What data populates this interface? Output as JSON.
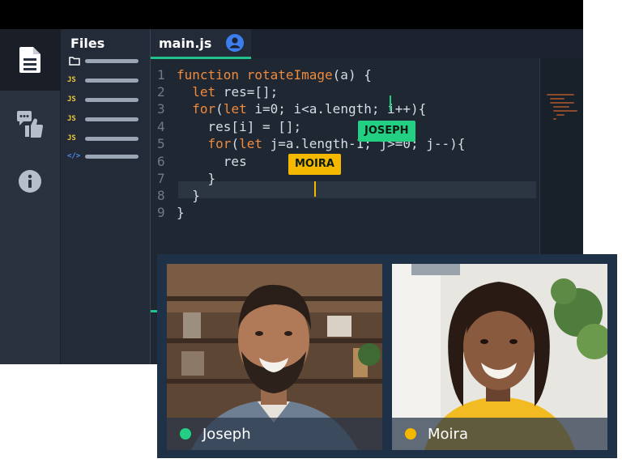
{
  "colors": {
    "joseph": "#23d083",
    "moira": "#f5b800",
    "accent": "#1fc28a",
    "tab_avatar": "#3c7df0"
  },
  "activity_bar": {
    "items": [
      {
        "icon": "document-icon",
        "active": true
      },
      {
        "icon": "chat-like-icon",
        "active": false
      },
      {
        "icon": "info-icon",
        "active": false
      }
    ]
  },
  "files_panel": {
    "title": "Files",
    "items": [
      {
        "type": "folder",
        "icon": "folder-icon",
        "label": ""
      },
      {
        "type": "js",
        "icon": "js-file-icon",
        "label": "JS"
      },
      {
        "type": "js",
        "icon": "js-file-icon",
        "label": "JS"
      },
      {
        "type": "js",
        "icon": "js-file-icon",
        "label": "JS"
      },
      {
        "type": "js",
        "icon": "js-file-icon",
        "label": "JS"
      },
      {
        "type": "code",
        "icon": "code-file-icon",
        "label": "</>"
      }
    ]
  },
  "editor": {
    "tab_label": "main.js",
    "tab_icon": "user-avatar-icon",
    "line_numbers": [
      "1",
      "2",
      "3",
      "4",
      "5",
      "6",
      "7",
      "8",
      "9"
    ],
    "code_lines": [
      "function rotateImage(a) {",
      "  let res=[];",
      "  for(let i=0; i<a.length; i++){",
      "    res[i] = [];",
      "    for(let j=a.length-1; j>=0; j--){",
      "      res",
      "    }",
      "  }",
      "}"
    ],
    "cursors": [
      {
        "name": "JOSEPH"
      },
      {
        "name": "MOIRA"
      }
    ]
  },
  "video_call": {
    "participants": [
      {
        "name": "Joseph",
        "status_color": "#23d083"
      },
      {
        "name": "Moira",
        "status_color": "#f5b800"
      }
    ]
  }
}
